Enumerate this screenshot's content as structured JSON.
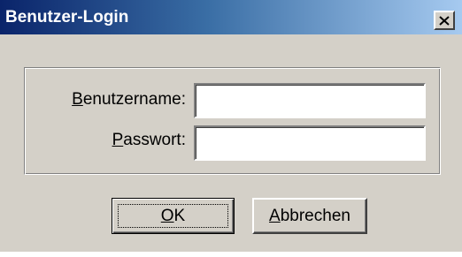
{
  "window": {
    "title": "Benutzer-Login",
    "close_icon": "close-icon"
  },
  "form": {
    "username": {
      "label_mnemonic": "B",
      "label_rest": "enutzername:",
      "value": ""
    },
    "password": {
      "label_mnemonic": "P",
      "label_rest": "asswort:",
      "value": ""
    }
  },
  "buttons": {
    "ok": {
      "mnemonic": "O",
      "rest": "K"
    },
    "cancel": {
      "mnemonic": "A",
      "rest": "bbrechen"
    }
  },
  "colors": {
    "titlebar_start": "#0a246a",
    "titlebar_end": "#a6caf0",
    "face": "#d4d0c8"
  }
}
